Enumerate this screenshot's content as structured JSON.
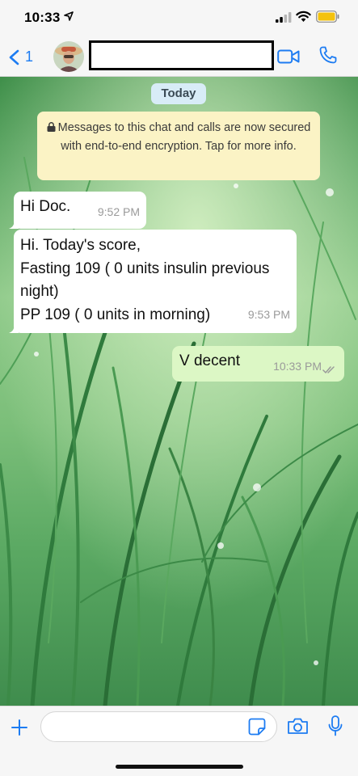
{
  "status_bar": {
    "time": "10:33"
  },
  "header": {
    "back_count": "1"
  },
  "chat": {
    "date_label": "Today",
    "encryption_notice": "Messages to this chat and calls are now secured with end-to-end encryption. Tap for more info.",
    "messages": [
      {
        "direction": "incoming",
        "lines": [
          "Hi Doc."
        ],
        "time": "9:52 PM"
      },
      {
        "direction": "incoming",
        "lines": [
          "Hi. Today's score,",
          "Fasting 109 ( 0 units insulin previous",
          "night)",
          "PP 109 ( 0 units in morning)"
        ],
        "time": "9:53 PM"
      },
      {
        "direction": "outgoing",
        "lines": [
          "V decent"
        ],
        "time": "10:33 PM",
        "status": "delivered"
      }
    ]
  },
  "composer": {
    "placeholder": ""
  },
  "colors": {
    "accent": "#1d7cf2",
    "incoming_bubble": "#ffffff",
    "outgoing_bubble": "#dcf7c5",
    "notice": "#fbf3c5",
    "date_pill": "#d8ecf7"
  },
  "icons": [
    "location-arrow-icon",
    "signal-icon",
    "wifi-icon",
    "battery-icon",
    "back-chevron-icon",
    "video-call-icon",
    "phone-icon",
    "lock-icon",
    "double-check-icon",
    "plus-icon",
    "sticker-icon",
    "camera-icon",
    "microphone-icon"
  ]
}
